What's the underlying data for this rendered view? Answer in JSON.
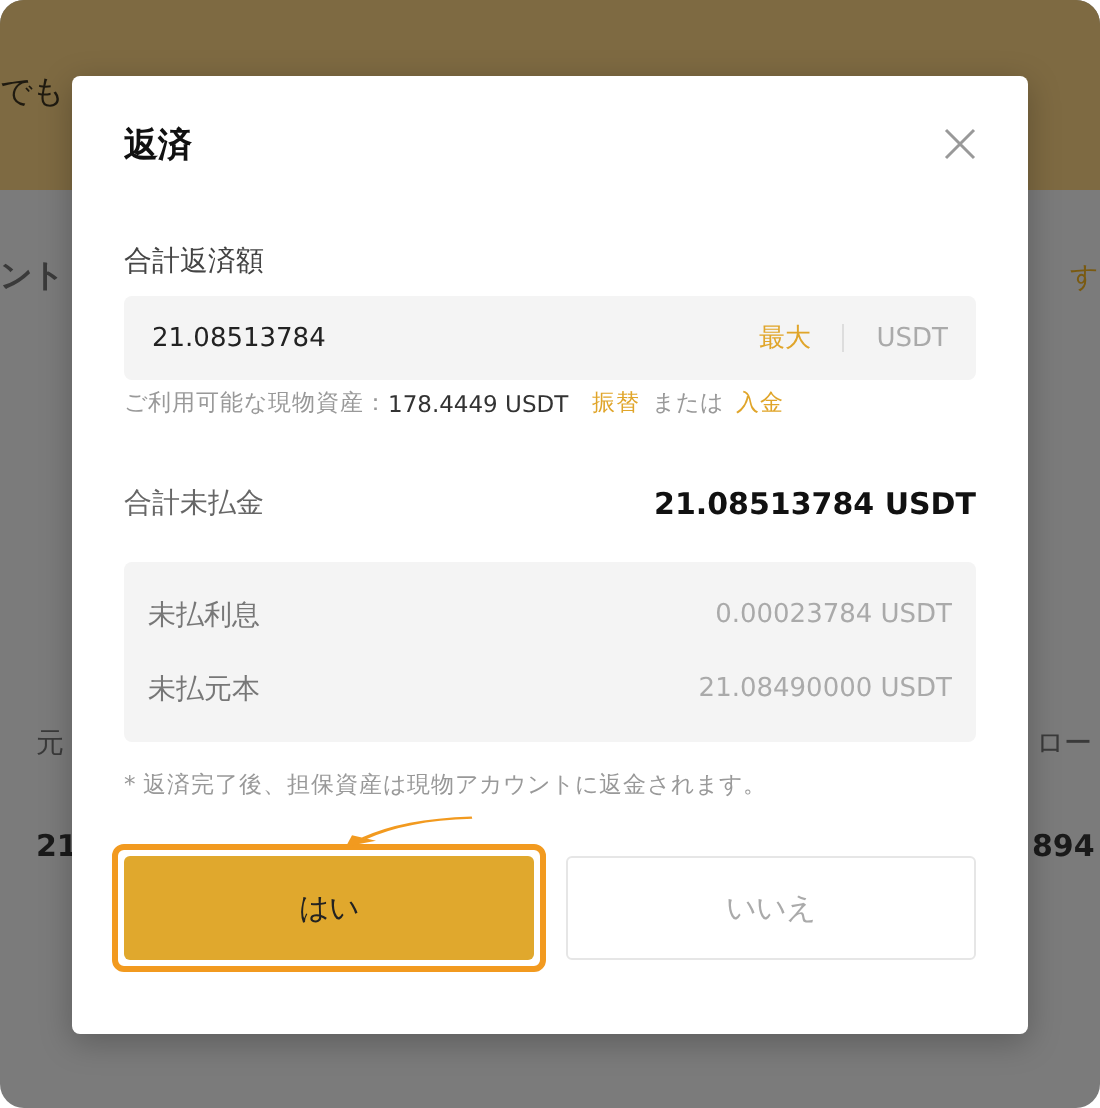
{
  "background": {
    "texts": [
      "でも",
      "ント",
      "す",
      "元",
      "ロー",
      "21",
      "894"
    ]
  },
  "dialog": {
    "title": "返済",
    "repay_amount": {
      "label": "合計返済額",
      "value": "21.08513784",
      "max_button": "最大",
      "currency": "USDT"
    },
    "available": {
      "label": "ご利用可能な現物資産：",
      "amount": "178.4449 USDT",
      "transfer_link": "振替",
      "or": "または",
      "deposit_link": "入金"
    },
    "total": {
      "label": "合計未払金",
      "value": "21.08513784 USDT"
    },
    "breakdown": [
      {
        "label": "未払利息",
        "value": "0.00023784 USDT"
      },
      {
        "label": "未払元本",
        "value": "21.08490000 USDT"
      }
    ],
    "note": "* 返済完了後、担保資産は現物アカウントに返金されます。",
    "buttons": [
      {
        "label": "はい",
        "kind": "primary",
        "highlighted": true
      },
      {
        "label": "いいえ",
        "kind": "secondary",
        "highlighted": false
      }
    ]
  }
}
